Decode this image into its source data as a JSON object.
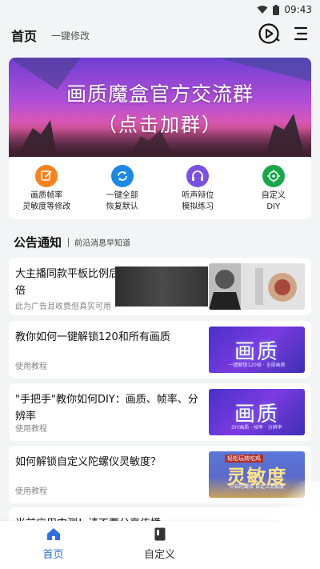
{
  "status_bar": {
    "time": "09:43"
  },
  "header": {
    "title": "首页",
    "subtitle": "一键修改"
  },
  "banner": {
    "line1": "画质魔盒官方交流群",
    "line2": "（点击加群）"
  },
  "quick_actions": [
    {
      "label": "画质帧率\n灵敏度等修改",
      "icon": "edit-icon",
      "color": "#f58220"
    },
    {
      "label": "一键全部\n恢复默认",
      "icon": "refresh-icon",
      "color": "#1e88e5"
    },
    {
      "label": "听声辩位\n模拟练习",
      "icon": "headset-icon",
      "color": "#7b4fe0"
    },
    {
      "label": "自定义\nDIY",
      "icon": "target-icon",
      "color": "#1aa64a"
    }
  ],
  "notice": {
    "title": "公告通知",
    "subtitle": "前沿消息早知道"
  },
  "articles": [
    {
      "title": "大主播同款平板比例后手感，游戏体验翻倍",
      "meta": "此为广告且收费但真实可用"
    },
    {
      "title": "教你如何一键解锁120和所有画质",
      "meta": "使用教程",
      "thumb_text": "画质",
      "thumb_sub": "一键解锁120帧 · 全部画质"
    },
    {
      "title": "\"手把手\"教你如何DIY：画质、帧率、分辨率",
      "meta": "使用教程",
      "thumb_text": "画质",
      "thumb_sub": "DIY画质 · 帧率 · 分辨率"
    },
    {
      "title": "如何解锁自定义陀螺仪灵敏度？",
      "meta": "使用教程",
      "thumb_text": "灵敏度",
      "thumb_banner": "轻松玩转吃鸡",
      "thumb_sub": "开启陀螺仪 自定义灵敏度"
    },
    {
      "title": "当前应用内测！请不要分享传播"
    }
  ],
  "bottom_nav": [
    {
      "label": "首页",
      "icon": "home-icon",
      "active": true
    },
    {
      "label": "自定义",
      "icon": "book-icon",
      "active": false
    }
  ],
  "colors": {
    "accent": "#2f6fdc",
    "banner_gradient": [
      "#6f3fd3",
      "#e65aa8"
    ]
  }
}
